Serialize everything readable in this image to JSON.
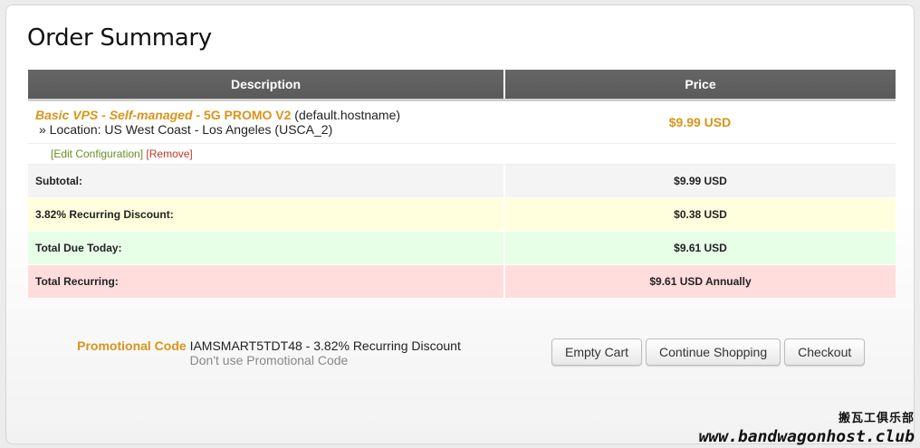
{
  "page": {
    "title": "Order Summary"
  },
  "table": {
    "headers": {
      "description": "Description",
      "price": "Price"
    },
    "item": {
      "product_name": "Basic VPS - Self-managed - ",
      "promo_tag": "5G PROMO V2",
      "hostname": " (default.hostname)",
      "location": "» Location: US West Coast - Los Angeles (USCA_2)",
      "price": "$9.99 USD",
      "edit_link": "[Edit Configuration]",
      "remove_link": "[Remove]"
    },
    "summary": {
      "subtotal_label": "Subtotal:",
      "subtotal_value": "$9.99 USD",
      "discount_label": "3.82% Recurring Discount:",
      "discount_value": "$0.38 USD",
      "due_today_label": "Total Due Today:",
      "due_today_value": "$9.61 USD",
      "recurring_label": "Total Recurring:",
      "recurring_value": "$9.61 USD Annually"
    }
  },
  "promo": {
    "label": "Promotional Code",
    "value": " IAMSMART5TDT48 - 3.82% Recurring Discount",
    "remove_text": "Don't use Promotional Code"
  },
  "buttons": {
    "empty_cart": "Empty Cart",
    "continue_shopping": "Continue Shopping",
    "checkout": "Checkout"
  },
  "watermark": {
    "chinese": "搬瓦工俱乐部",
    "url": "www.bandwagonhost.club"
  },
  "colors": {
    "accent_orange": "#d9941a",
    "header_gray": "#5f5f5f",
    "discount_bg": "#ffffdd",
    "due_bg": "#e6ffe6",
    "recurring_bg": "#ffdddd"
  }
}
